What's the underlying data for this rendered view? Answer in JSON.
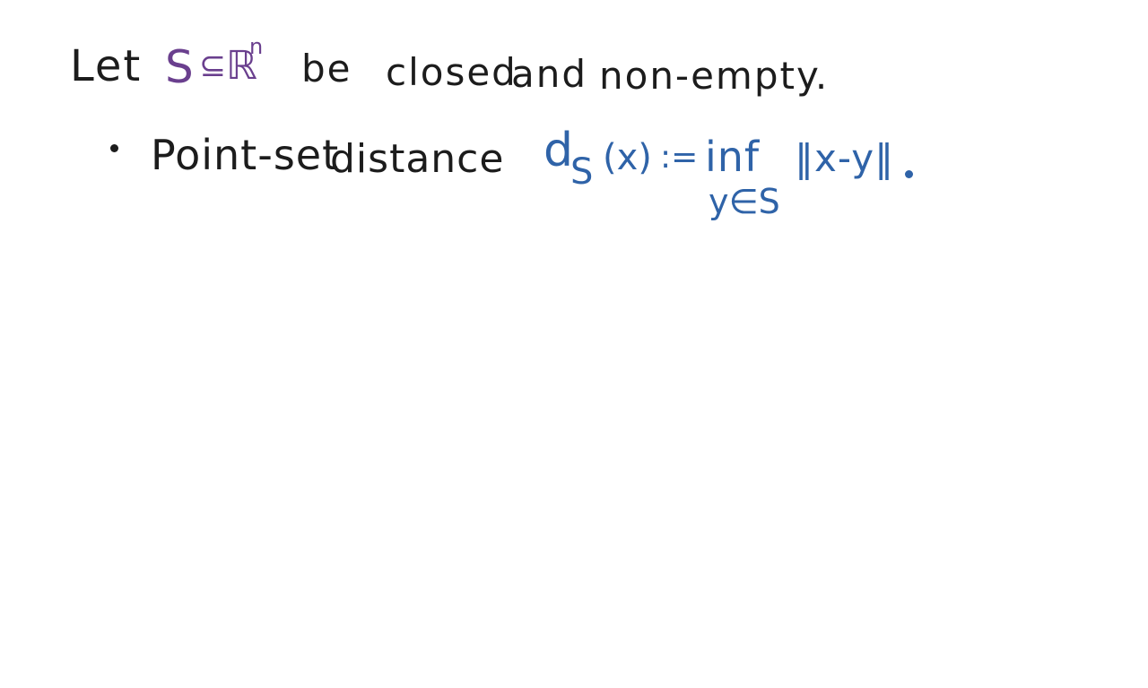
{
  "line1": {
    "let": "Let",
    "set_symbol": "S",
    "subset": "⊆",
    "reals": "ℝ",
    "exponent": "n",
    "be": "be",
    "closed": "closed",
    "and": "and",
    "non_empty": "non-empty."
  },
  "bullet1": {
    "label_part1": "Point-set",
    "label_part2": "distance",
    "formula": {
      "d": "d",
      "subscript": "S",
      "arg": "(x)",
      "defined_as": ":=",
      "operator": "inf",
      "operator_sub": "y∈S",
      "expression": "‖x-y‖"
    }
  },
  "colors": {
    "black_ink": "#1c1c1c",
    "purple_ink": "#6a3f8e",
    "blue_ink": "#2f63a8",
    "background": "#ffffff"
  }
}
